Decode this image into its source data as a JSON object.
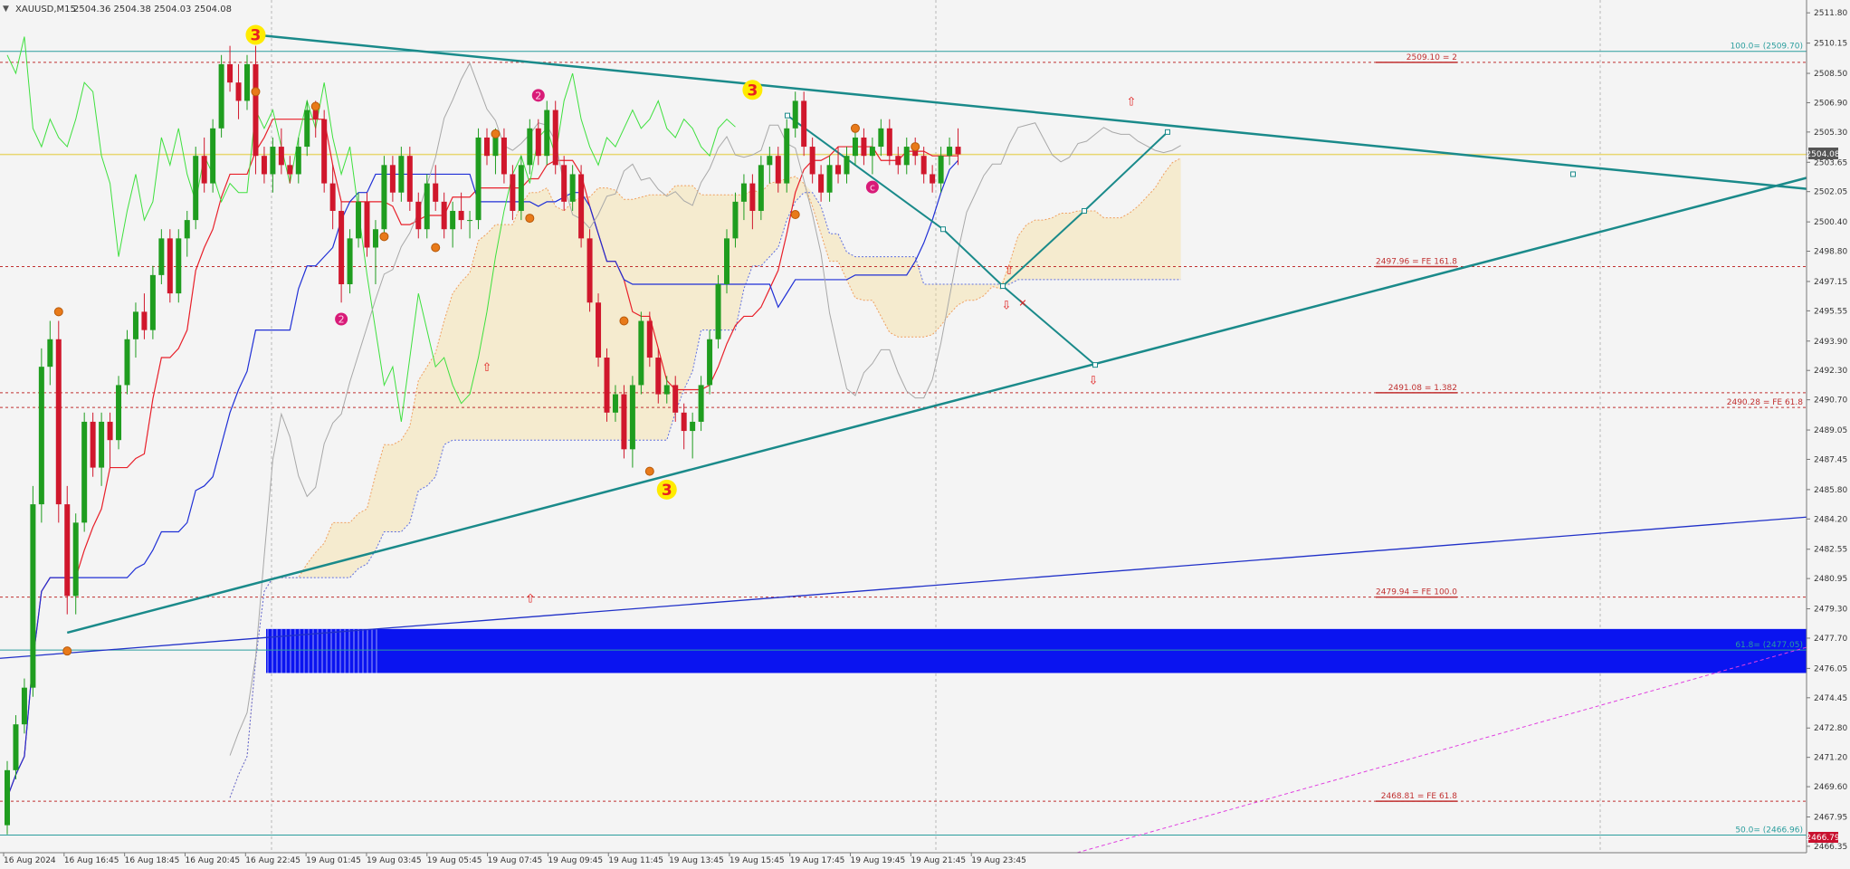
{
  "header": {
    "symbol": "XAUUSD,M15",
    "ohlc": "2504.36 2504.38 2504.03 2504.08"
  },
  "chart_data": {
    "type": "candlestick",
    "symbol": "XAUUSD",
    "timeframe": "M15",
    "ylim": [
      2466.0,
      2512.5
    ],
    "price_ticks": [
      "2511.80",
      "2510.15",
      "2508.50",
      "2506.90",
      "2505.30",
      "2503.65",
      "2502.05",
      "2500.40",
      "2498.80",
      "2497.15",
      "2495.55",
      "2493.90",
      "2492.30",
      "2490.70",
      "2489.05",
      "2487.45",
      "2485.80",
      "2484.20",
      "2482.55",
      "2480.95",
      "2479.30",
      "2477.70",
      "2476.05",
      "2474.45",
      "2472.80",
      "2471.20",
      "2469.60",
      "2467.95",
      "2466.35"
    ],
    "time_labels": [
      "16 Aug 2024",
      "16 Aug 16:45",
      "16 Aug 18:45",
      "16 Aug 20:45",
      "16 Aug 22:45",
      "19 Aug 01:45",
      "19 Aug 03:45",
      "19 Aug 05:45",
      "19 Aug 07:45",
      "19 Aug 09:45",
      "19 Aug 11:45",
      "19 Aug 13:45",
      "19 Aug 15:45",
      "19 Aug 17:45",
      "19 Aug 19:45",
      "19 Aug 21:45",
      "19 Aug 23:45"
    ],
    "current_price": "2504.08",
    "bottom_price": "2466.79",
    "candles": [
      [
        2467.5,
        2471.0,
        2467.0,
        2470.5
      ],
      [
        2470.5,
        2473.5,
        2470.0,
        2473.0
      ],
      [
        2473.0,
        2475.5,
        2472.5,
        2475.0
      ],
      [
        2475.0,
        2486.0,
        2474.5,
        2485.0
      ],
      [
        2485.0,
        2493.5,
        2484.0,
        2492.5
      ],
      [
        2492.5,
        2495.0,
        2491.5,
        2494.0
      ],
      [
        2494.0,
        2495.0,
        2484.0,
        2485.0
      ],
      [
        2485.0,
        2486.0,
        2479.0,
        2480.0
      ],
      [
        2480.0,
        2484.5,
        2479.0,
        2484.0
      ],
      [
        2484.0,
        2490.0,
        2483.5,
        2489.5
      ],
      [
        2489.5,
        2490.0,
        2486.5,
        2487.0
      ],
      [
        2487.0,
        2490.0,
        2486.0,
        2489.5
      ],
      [
        2489.5,
        2490.0,
        2487.0,
        2488.5
      ],
      [
        2488.5,
        2492.0,
        2488.0,
        2491.5
      ],
      [
        2491.5,
        2494.5,
        2491.0,
        2494.0
      ],
      [
        2494.0,
        2496.0,
        2493.0,
        2495.5
      ],
      [
        2495.5,
        2496.5,
        2494.0,
        2494.5
      ],
      [
        2494.5,
        2498.0,
        2494.0,
        2497.5
      ],
      [
        2497.5,
        2500.0,
        2497.0,
        2499.5
      ],
      [
        2499.5,
        2500.0,
        2496.0,
        2496.5
      ],
      [
        2496.5,
        2500.0,
        2496.0,
        2499.5
      ],
      [
        2499.5,
        2501.0,
        2498.5,
        2500.5
      ],
      [
        2500.5,
        2504.5,
        2500.0,
        2504.0
      ],
      [
        2504.0,
        2505.0,
        2502.0,
        2502.5
      ],
      [
        2502.5,
        2506.0,
        2502.0,
        2505.5
      ],
      [
        2505.5,
        2509.5,
        2505.0,
        2509.0
      ],
      [
        2509.0,
        2510.0,
        2507.5,
        2508.0
      ],
      [
        2508.0,
        2509.0,
        2506.0,
        2507.0
      ],
      [
        2507.0,
        2509.5,
        2506.5,
        2509.0
      ],
      [
        2509.0,
        2510.0,
        2503.0,
        2504.0
      ],
      [
        2504.0,
        2504.5,
        2502.5,
        2503.0
      ],
      [
        2503.0,
        2505.0,
        2502.0,
        2504.5
      ],
      [
        2504.5,
        2505.5,
        2503.0,
        2503.5
      ],
      [
        2503.5,
        2504.0,
        2502.5,
        2503.0
      ],
      [
        2503.0,
        2505.0,
        2502.5,
        2504.5
      ],
      [
        2504.5,
        2507.0,
        2504.0,
        2506.5
      ],
      [
        2506.5,
        2507.0,
        2505.0,
        2506.0
      ],
      [
        2506.0,
        2506.5,
        2502.0,
        2502.5
      ],
      [
        2502.5,
        2503.5,
        2500.0,
        2501.0
      ],
      [
        2501.0,
        2501.5,
        2496.0,
        2497.0
      ],
      [
        2497.0,
        2500.0,
        2496.5,
        2499.5
      ],
      [
        2499.5,
        2502.0,
        2499.0,
        2501.5
      ],
      [
        2501.5,
        2502.0,
        2498.5,
        2499.0
      ],
      [
        2499.0,
        2500.5,
        2497.0,
        2500.0
      ],
      [
        2500.0,
        2504.0,
        2499.5,
        2503.5
      ],
      [
        2503.5,
        2504.0,
        2501.5,
        2502.0
      ],
      [
        2502.0,
        2504.5,
        2501.5,
        2504.0
      ],
      [
        2504.0,
        2504.5,
        2501.0,
        2501.5
      ],
      [
        2501.5,
        2502.0,
        2499.5,
        2500.0
      ],
      [
        2500.0,
        2503.0,
        2499.5,
        2502.5
      ],
      [
        2502.5,
        2503.5,
        2501.0,
        2501.5
      ],
      [
        2501.5,
        2502.0,
        2499.5,
        2500.0
      ],
      [
        2500.0,
        2501.5,
        2499.0,
        2501.0
      ],
      [
        2501.0,
        2502.0,
        2500.0,
        2500.5
      ],
      [
        2500.5,
        2501.0,
        2499.5,
        2500.5
      ],
      [
        2500.5,
        2505.5,
        2500.0,
        2505.0
      ],
      [
        2505.0,
        2505.5,
        2503.5,
        2504.0
      ],
      [
        2504.0,
        2505.5,
        2503.0,
        2505.0
      ],
      [
        2505.0,
        2505.5,
        2502.5,
        2503.0
      ],
      [
        2503.0,
        2503.5,
        2500.5,
        2501.0
      ],
      [
        2501.0,
        2504.0,
        2500.5,
        2503.5
      ],
      [
        2503.5,
        2506.0,
        2503.0,
        2505.5
      ],
      [
        2505.5,
        2506.0,
        2503.5,
        2504.0
      ],
      [
        2504.0,
        2507.0,
        2503.5,
        2506.5
      ],
      [
        2506.5,
        2507.0,
        2503.0,
        2503.5
      ],
      [
        2503.5,
        2504.0,
        2501.0,
        2501.5
      ],
      [
        2501.5,
        2503.5,
        2501.0,
        2503.0
      ],
      [
        2503.0,
        2503.5,
        2499.0,
        2499.5
      ],
      [
        2499.5,
        2500.0,
        2495.5,
        2496.0
      ],
      [
        2496.0,
        2496.5,
        2492.5,
        2493.0
      ],
      [
        2493.0,
        2493.5,
        2489.5,
        2490.0
      ],
      [
        2490.0,
        2491.5,
        2489.5,
        2491.0
      ],
      [
        2491.0,
        2491.5,
        2487.5,
        2488.0
      ],
      [
        2488.0,
        2492.0,
        2487.0,
        2491.5
      ],
      [
        2491.5,
        2495.5,
        2491.0,
        2495.0
      ],
      [
        2495.0,
        2495.5,
        2492.5,
        2493.0
      ],
      [
        2493.0,
        2493.5,
        2490.5,
        2491.0
      ],
      [
        2491.0,
        2492.0,
        2490.5,
        2491.5
      ],
      [
        2491.5,
        2492.0,
        2489.5,
        2490.0
      ],
      [
        2490.0,
        2490.5,
        2488.0,
        2489.0
      ],
      [
        2489.0,
        2490.0,
        2487.5,
        2489.5
      ],
      [
        2489.5,
        2492.0,
        2489.0,
        2491.5
      ],
      [
        2491.5,
        2494.5,
        2491.0,
        2494.0
      ],
      [
        2494.0,
        2497.5,
        2493.5,
        2497.0
      ],
      [
        2497.0,
        2500.0,
        2496.5,
        2499.5
      ],
      [
        2499.5,
        2502.0,
        2499.0,
        2501.5
      ],
      [
        2501.5,
        2503.0,
        2500.5,
        2502.5
      ],
      [
        2502.5,
        2503.0,
        2500.0,
        2501.0
      ],
      [
        2501.0,
        2504.0,
        2500.5,
        2503.5
      ],
      [
        2503.5,
        2504.5,
        2502.5,
        2504.0
      ],
      [
        2504.0,
        2504.5,
        2502.0,
        2502.5
      ],
      [
        2502.5,
        2506.0,
        2502.0,
        2505.5
      ],
      [
        2505.5,
        2507.5,
        2505.0,
        2507.0
      ],
      [
        2507.0,
        2507.5,
        2504.0,
        2504.5
      ],
      [
        2504.5,
        2505.0,
        2502.5,
        2503.0
      ],
      [
        2503.0,
        2503.5,
        2501.5,
        2502.0
      ],
      [
        2502.0,
        2504.0,
        2501.5,
        2503.5
      ],
      [
        2503.5,
        2504.5,
        2502.5,
        2503.0
      ],
      [
        2503.0,
        2504.5,
        2502.5,
        2504.0
      ],
      [
        2504.0,
        2505.5,
        2503.5,
        2505.0
      ],
      [
        2505.0,
        2505.5,
        2503.5,
        2504.0
      ],
      [
        2504.0,
        2505.0,
        2503.0,
        2504.5
      ],
      [
        2504.5,
        2506.0,
        2504.0,
        2505.5
      ],
      [
        2505.5,
        2506.0,
        2503.5,
        2504.0
      ],
      [
        2504.0,
        2504.5,
        2503.0,
        2503.5
      ],
      [
        2503.5,
        2505.0,
        2503.0,
        2504.5
      ],
      [
        2504.5,
        2505.0,
        2503.5,
        2504.0
      ],
      [
        2504.0,
        2504.5,
        2502.5,
        2503.0
      ],
      [
        2503.0,
        2503.5,
        2502.0,
        2502.5
      ],
      [
        2502.5,
        2504.5,
        2502.0,
        2504.0
      ],
      [
        2504.0,
        2505.0,
        2503.5,
        2504.5
      ],
      [
        2504.5,
        2505.5,
        2503.5,
        2504.08
      ]
    ],
    "horizontal_levels": [
      {
        "price": 2509.7,
        "label": "100.0= (2509.70)",
        "color": "#2a9d9d",
        "style": "solid",
        "label_side": "right"
      },
      {
        "price": 2509.1,
        "label": "2509.10 = 2",
        "color": "#c03030",
        "style": "dashed",
        "label_side": "mid"
      },
      {
        "price": 2504.08,
        "label": "",
        "color": "#e8d770",
        "style": "solid",
        "label_side": "none"
      },
      {
        "price": 2497.96,
        "label": "2497.96 = FE 161.8",
        "color": "#c03030",
        "style": "dashed",
        "label_side": "mid"
      },
      {
        "price": 2491.08,
        "label": "2491.08 = 1.382",
        "color": "#c03030",
        "style": "dashed",
        "label_side": "mid"
      },
      {
        "price": 2490.28,
        "label": "2490.28 = FE 61.8",
        "color": "#c03030",
        "style": "dashed",
        "label_side": "right"
      },
      {
        "price": 2479.94,
        "label": "2479.94 = FE 100.0",
        "color": "#c03030",
        "style": "dashed",
        "label_side": "mid"
      },
      {
        "price": 2477.05,
        "label": "61.8= (2477.05)",
        "color": "#2a9d9d",
        "style": "solid",
        "label_side": "right"
      },
      {
        "price": 2468.81,
        "label": "2468.81 = FE 61.8",
        "color": "#c03030",
        "style": "dashed",
        "label_side": "mid"
      },
      {
        "price": 2466.96,
        "label": "50.0= (2466.96)",
        "color": "#2a9d9d",
        "style": "solid",
        "label_side": "right"
      }
    ],
    "wave_labels": [
      {
        "text": "3",
        "candle": 29,
        "price": 2510.6,
        "kind": "big"
      },
      {
        "text": "3",
        "candle": 87,
        "price": 2507.6,
        "kind": "big"
      },
      {
        "text": "3",
        "candle": 77,
        "price": 2485.8,
        "kind": "big"
      },
      {
        "text": "2",
        "candle": 62,
        "price": 2507.3,
        "kind": "pink"
      },
      {
        "text": "2",
        "candle": 39,
        "price": 2495.1,
        "kind": "pink"
      },
      {
        "text": "c",
        "candle": 101,
        "price": 2502.3,
        "kind": "pink"
      }
    ],
    "colors": {
      "bull": "#1f9d1f",
      "bear": "#d0172c",
      "tenkan": "#e8202a",
      "kijun": "#1f2fd6",
      "chikou": "#3ee03e",
      "trend": "#1a8a8a",
      "zone": "#0a14f0",
      "price_badge": "#555555",
      "bottom_badge": "#c8102e"
    }
  }
}
